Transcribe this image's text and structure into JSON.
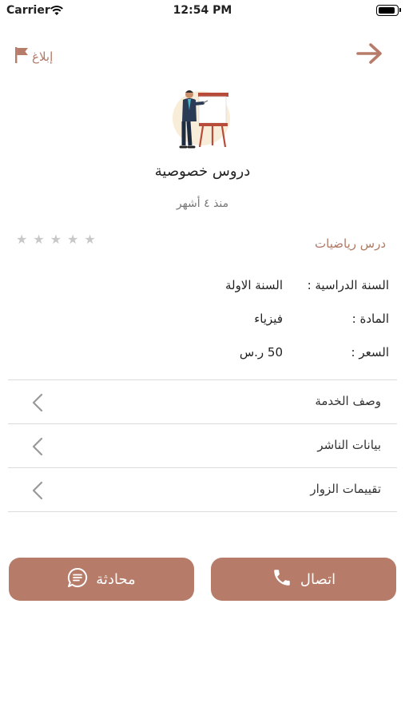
{
  "status_bar": {
    "carrier": "Carrier",
    "time": "12:54 PM"
  },
  "header": {
    "report_label": "إبلاغ"
  },
  "ad": {
    "title": "دروس خصوصية",
    "time_ago": "منذ ٤ أشهر",
    "name": "درس رياضيات",
    "rating": {
      "value": 0,
      "max": 5
    }
  },
  "details": [
    {
      "label": "السنة الدراسية :",
      "value": "السنة الاولة"
    },
    {
      "label": "المادة :",
      "value": "فيزياء"
    },
    {
      "label": "السعر :",
      "value": "50 ر.س"
    }
  ],
  "sections": [
    {
      "label": "وصف الخدمة"
    },
    {
      "label": "بيانات الناشر"
    },
    {
      "label": "تقييمات الزوار"
    }
  ],
  "actions": {
    "chat_label": "محادثة",
    "call_label": "اتصال"
  },
  "colors": {
    "accent": "#b67c69",
    "accent_text": "#b07a66",
    "divider": "#dcdcdc",
    "star": "#c8c8c8"
  }
}
